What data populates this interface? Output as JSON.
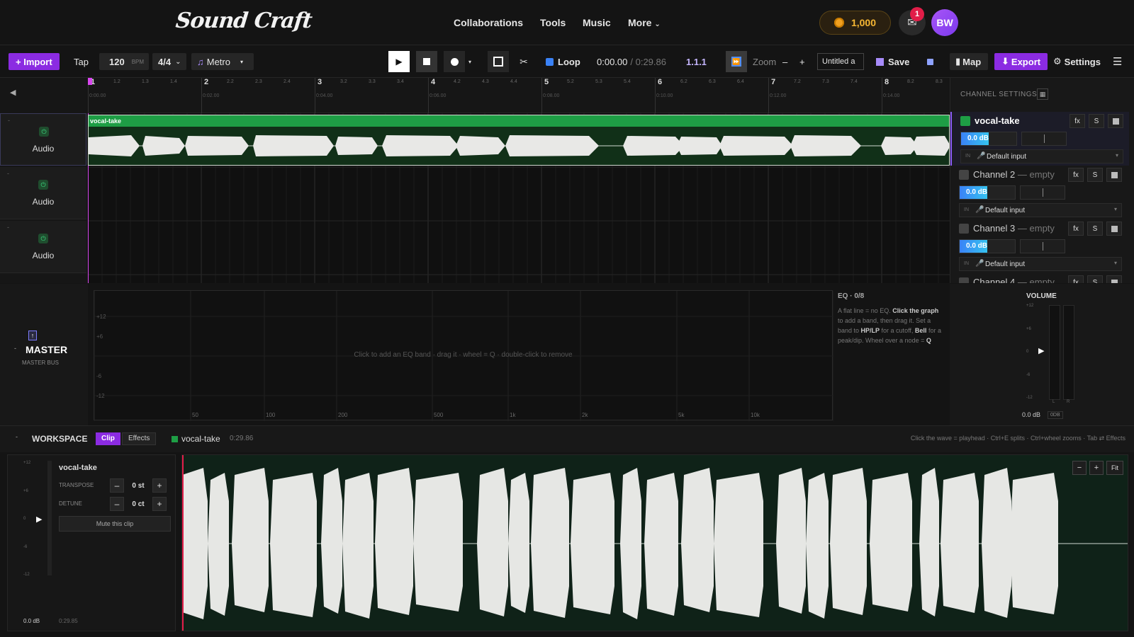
{
  "nav": {
    "logo": "Sound Craft",
    "links": [
      "Collaborations",
      "Tools",
      "Music"
    ],
    "more": "More",
    "coins": "1,000",
    "mail_count": "1",
    "avatar_initials": "BW"
  },
  "toolbar": {
    "import": "+ Import",
    "tap": "Tap",
    "bpm": "120",
    "bpm_unit": "BPM",
    "signature": "4/4",
    "metro": "Metro",
    "loop": "Loop",
    "time_current": "0:00.00",
    "time_total": "/ 0:29.86",
    "position": "1.1.1",
    "zoom": "Zoom",
    "project_name": "Untitled a",
    "save": "Save",
    "map": "Map",
    "export": "Export",
    "settings": "Settings"
  },
  "ruler": {
    "bars": [
      "1",
      "2",
      "3",
      "4",
      "5",
      "6",
      "7",
      "8"
    ],
    "times": [
      "0:00.00",
      "0:02.00",
      "0:04.00",
      "0:06.00",
      "0:08.00",
      "0:10.00",
      "0:12.00",
      "0:14.00"
    ]
  },
  "tracks": [
    {
      "label": "Audio"
    },
    {
      "label": "Audio"
    },
    {
      "label": "Audio"
    }
  ],
  "clip": {
    "name": "vocal-take"
  },
  "channels": {
    "title": "CHANNEL SETTINGS",
    "rows": [
      {
        "name": "vocal-take",
        "empty": "",
        "color": "#1e9e45",
        "db": "0.0 dB",
        "input": "Default input"
      },
      {
        "name": "Channel 2",
        "empty": "— empty",
        "color": "#444444",
        "db": "0.0 dB",
        "input": "Default input"
      },
      {
        "name": "Channel 3",
        "empty": "— empty",
        "color": "#444444",
        "db": "0.0 dB",
        "input": "Default input"
      },
      {
        "name": "Channel 4",
        "empty": "— empty",
        "color": "#444444",
        "db": "",
        "input": ""
      }
    ],
    "fx": "fx",
    "solo": "S",
    "in": "IN"
  },
  "master": {
    "title": "MASTER",
    "subtitle": "MASTER BUS"
  },
  "eq": {
    "title": "EQ · 0/8",
    "hint": "Click to add an EQ band · drag it · wheel = Q · double-click to remove",
    "y_ticks": [
      "+12",
      "+6",
      "-6",
      "-12"
    ],
    "x_ticks": [
      "50",
      "100",
      "200",
      "500",
      "1k",
      "2k",
      "5k",
      "10k"
    ],
    "info": {
      "t1": "A flat line = no EQ. ",
      "b1": "Click the graph",
      "t2": " to add a band, then drag it. Set a band to ",
      "b2": "HP/LP",
      "t3": " for a cutoff, ",
      "b3": "Bell",
      "t4": " for a peak/dip. Wheel over a node = ",
      "b4": "Q"
    }
  },
  "volume": {
    "title": "VOLUME",
    "ticks": [
      "+12",
      "+6",
      "0",
      "-6",
      "-12"
    ],
    "db": "0.0 dB",
    "odb": "0DB",
    "l": "L",
    "r": "R"
  },
  "workspace": {
    "title": "WORKSPACE",
    "tabs": [
      "Clip",
      "Effects"
    ],
    "clip_name": "vocal-take",
    "clip_len": "0:29.86",
    "shortcuts": "Click the wave = playhead · Ctrl+E splits · Ctrl+wheel zooms · Tab ⇄ Effects"
  },
  "clip_panel": {
    "name": "vocal-take",
    "transpose_label": "TRANSPOSE",
    "transpose_value": "0 st",
    "detune_label": "DETUNE",
    "detune_value": "0 ct",
    "mute": "Mute this clip",
    "ticks": [
      "+12",
      "+6",
      "0",
      "-6",
      "-12"
    ],
    "db": "0.0 dB",
    "len": "0:29.85"
  },
  "wave_controls": {
    "minus": "−",
    "plus": "+",
    "fit": "Fit"
  }
}
